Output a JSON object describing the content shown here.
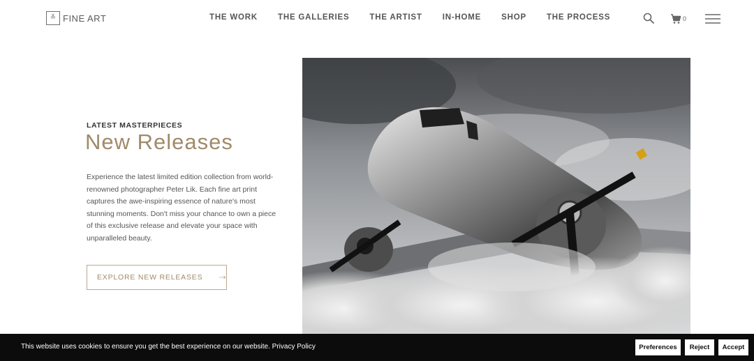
{
  "header": {
    "logo_text": "FINE ART",
    "logo_mark": "≚",
    "nav": [
      {
        "label": "THE WORK"
      },
      {
        "label": "THE GALLERIES"
      },
      {
        "label": "THE ARTIST"
      },
      {
        "label": "IN-HOME"
      },
      {
        "label": "SHOP"
      },
      {
        "label": "THE PROCESS"
      }
    ],
    "cart_count": "0",
    "icons": {
      "search": "search-icon",
      "cart": "cart-icon",
      "menu": "hamburger-menu-icon"
    }
  },
  "hero": {
    "eyebrow": "LATEST MASTERPIECES",
    "title": "New Releases",
    "body": "Experience the latest limited edition collection from world-renowned photographer Peter Lik. Each fine art print captures the awe-inspiring essence of nature's most stunning moments. Don't miss your chance to own a piece of this exclusive release and elevate your space with unparalleled beauty.",
    "cta_label": "EXPLORE NEW RELEASES",
    "accent_color": "#a08a6a"
  },
  "cookie": {
    "message": "This website uses cookies to ensure you get the best experience on our website.",
    "link_label": "Privacy Policy",
    "preferences_label": "Preferences",
    "reject_label": "Reject",
    "accept_label": "Accept"
  }
}
